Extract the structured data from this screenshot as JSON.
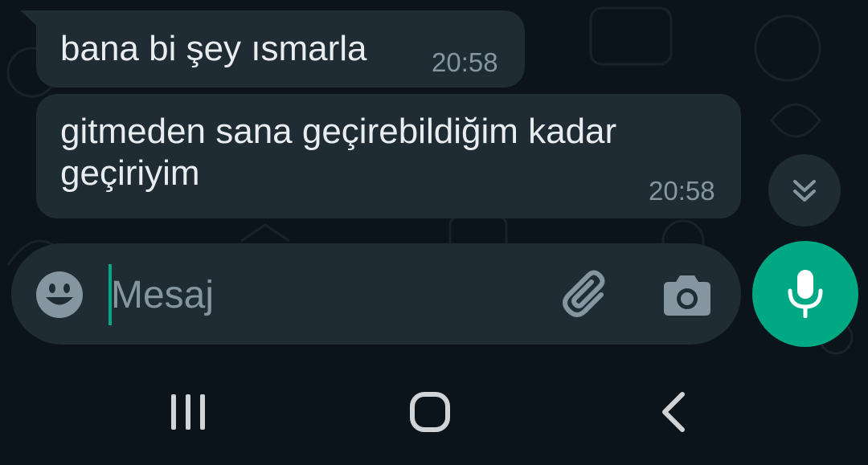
{
  "messages": [
    {
      "text": "bana bi şey ısmarla",
      "time": "20:58"
    },
    {
      "text": "gitmeden sana geçirebildiğim kadar\ngeçiriyim",
      "time": "20:58"
    }
  ],
  "input": {
    "placeholder": "Mesaj",
    "value": ""
  },
  "icons": {
    "scroll": "double-chevron-down-icon",
    "emoji": "emoji-icon",
    "attach": "paperclip-icon",
    "camera": "camera-icon",
    "mic": "microphone-icon",
    "nav_recents": "recents-icon",
    "nav_home": "home-icon",
    "nav_back": "back-icon"
  },
  "colors": {
    "background": "#0b141a",
    "bubble": "#1f2c34",
    "text": "#e9edef",
    "secondary_text": "#8696a0",
    "accent": "#00a884"
  }
}
